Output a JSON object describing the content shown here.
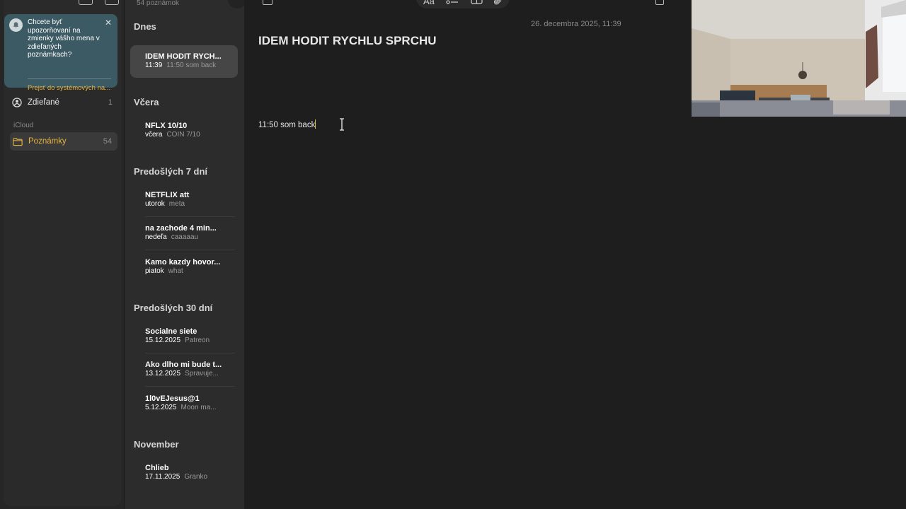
{
  "sidebar": {
    "notification": {
      "text": "Chcete byť upozorňovaní na zmienky vášho mena v zdieľaných poznámkach?",
      "link": "Prejsť do systémových na..."
    },
    "shared": {
      "label": "Zdieľané",
      "count": "1"
    },
    "section": "iCloud",
    "folder": {
      "label": "Poznámky",
      "count": "54"
    }
  },
  "list": {
    "count": "54 poznámok",
    "groups": [
      {
        "header": "Dnes",
        "notes": [
          {
            "title": "IDEM HODIT RYCH...",
            "date": "11:39",
            "preview": "11:50 som back"
          }
        ]
      },
      {
        "header": "Včera",
        "notes": [
          {
            "title": "NFLX 10/10",
            "date": "včera",
            "preview": "COIN 7/10"
          }
        ]
      },
      {
        "header": "Predošlých 7 dní",
        "notes": [
          {
            "title": "NETFLIX att",
            "date": "utorok",
            "preview": "meta"
          },
          {
            "title": "na zachode 4 min...",
            "date": "nedeľa",
            "preview": "caaaaau"
          },
          {
            "title": "Kamo kazdy hovor...",
            "date": "piatok",
            "preview": "what"
          }
        ]
      },
      {
        "header": "Predošlých 30 dní",
        "notes": [
          {
            "title": "Socialne siete",
            "date": "15.12.2025",
            "preview": "Patreon"
          },
          {
            "title": "Ako dlho mi bude t...",
            "date": "13.12.2025",
            "preview": "Spravuje..."
          },
          {
            "title": "1l0vEJesus@1",
            "date": "5.12.2025",
            "preview": "Moon ma..."
          }
        ]
      },
      {
        "header": "November",
        "notes": [
          {
            "title": "Chlieb",
            "date": "17.11.2025",
            "preview": "Granko"
          }
        ]
      }
    ]
  },
  "editor": {
    "toolbar": {
      "format_label": "Aa"
    },
    "date": "26. decembra 2025, 11:39",
    "title": "IDEM HODIT RYCHLU SPRCHU",
    "body": "11:50 som back"
  },
  "colors": {
    "accent": "#e8b640",
    "background": "#1e1e1e",
    "notification": "#3c5a63"
  }
}
